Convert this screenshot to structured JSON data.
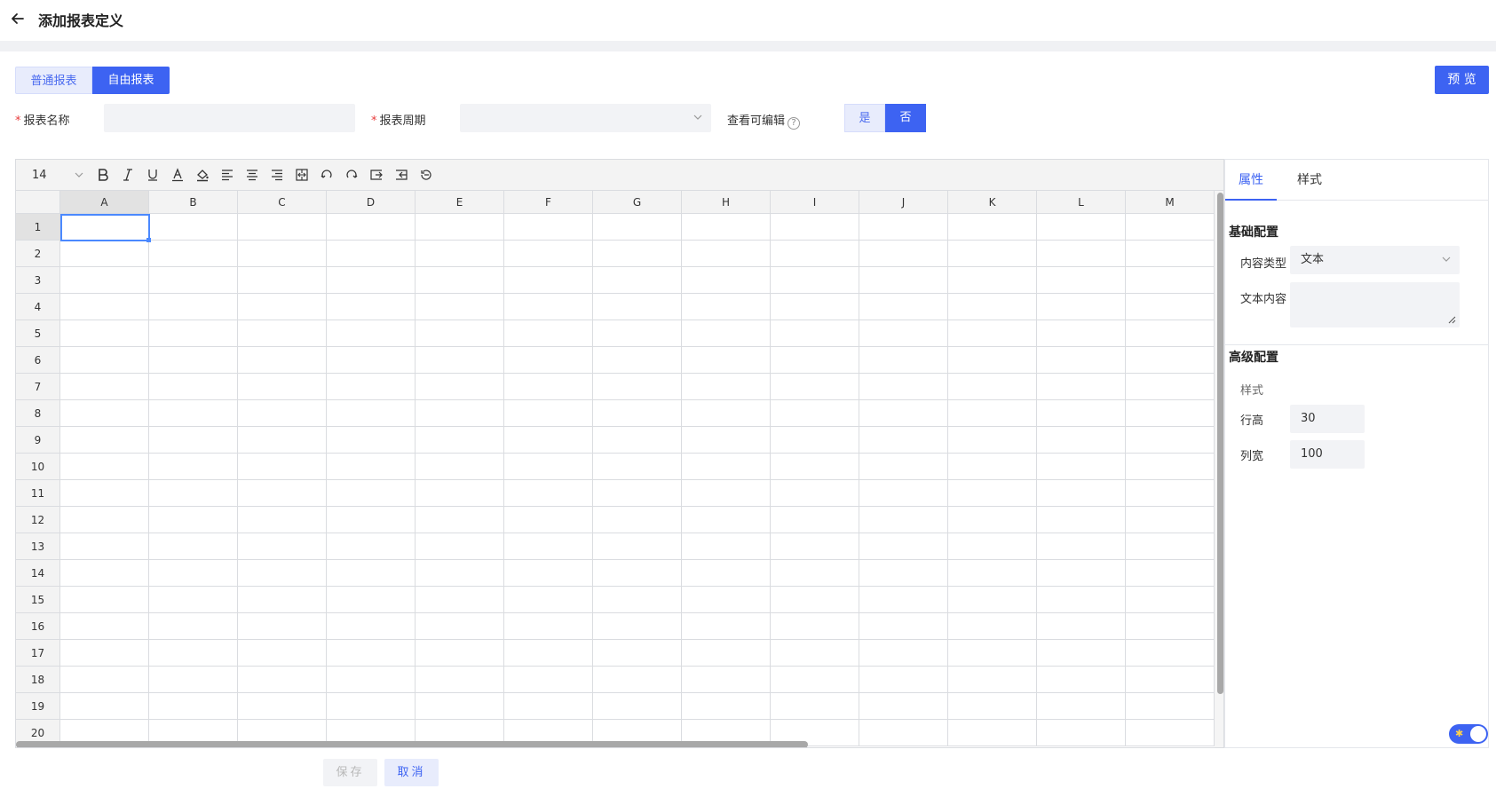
{
  "header": {
    "title": "添加报表定义",
    "back_icon": "arrow-left-icon"
  },
  "tabs": [
    {
      "label": "普通报表",
      "active": false
    },
    {
      "label": "自由报表",
      "active": true
    }
  ],
  "preview_button": "预 览",
  "form": {
    "name_label": "报表名称",
    "name_value": "",
    "period_label": "报表周期",
    "period_value": "",
    "editable_label": "查看可编辑",
    "editable_yes": "是",
    "editable_no": "否",
    "editable_selected": "否",
    "required_mark": "*"
  },
  "toolbar": {
    "font_size": "14",
    "buttons": [
      "bold-icon",
      "italic-icon",
      "underline-icon",
      "font-color-icon",
      "fill-color-icon",
      "align-left-icon",
      "align-center-icon",
      "align-right-icon",
      "merge-cells-icon",
      "undo-icon",
      "redo-icon",
      "insert-row-icon",
      "insert-col-icon",
      "clear-icon"
    ]
  },
  "sheet": {
    "columns": [
      "A",
      "B",
      "C",
      "D",
      "E",
      "F",
      "G",
      "H",
      "I",
      "J",
      "K",
      "L",
      "M"
    ],
    "rows": [
      "1",
      "2",
      "3",
      "4",
      "5",
      "6",
      "7",
      "8",
      "9",
      "10",
      "11",
      "12",
      "13",
      "14",
      "15",
      "16",
      "17",
      "18",
      "19",
      "20"
    ],
    "selected_cell": "A1"
  },
  "panel": {
    "tabs": [
      {
        "label": "属性",
        "active": true
      },
      {
        "label": "样式",
        "active": false
      }
    ],
    "basic_title": "基础配置",
    "content_type_label": "内容类型",
    "content_type_value": "文本",
    "text_content_label": "文本内容",
    "text_content_value": "",
    "advanced_title": "高级配置",
    "style_label": "样式",
    "row_height_label": "行高",
    "row_height_value": "30",
    "col_width_label": "列宽",
    "col_width_value": "100"
  },
  "footer": {
    "save_label": "保存",
    "cancel_label": "取消"
  },
  "colors": {
    "primary": "#3d63f2",
    "primary_light": "#e8ecfc",
    "input_bg": "#f2f3f6",
    "required": "#e83a3a"
  }
}
